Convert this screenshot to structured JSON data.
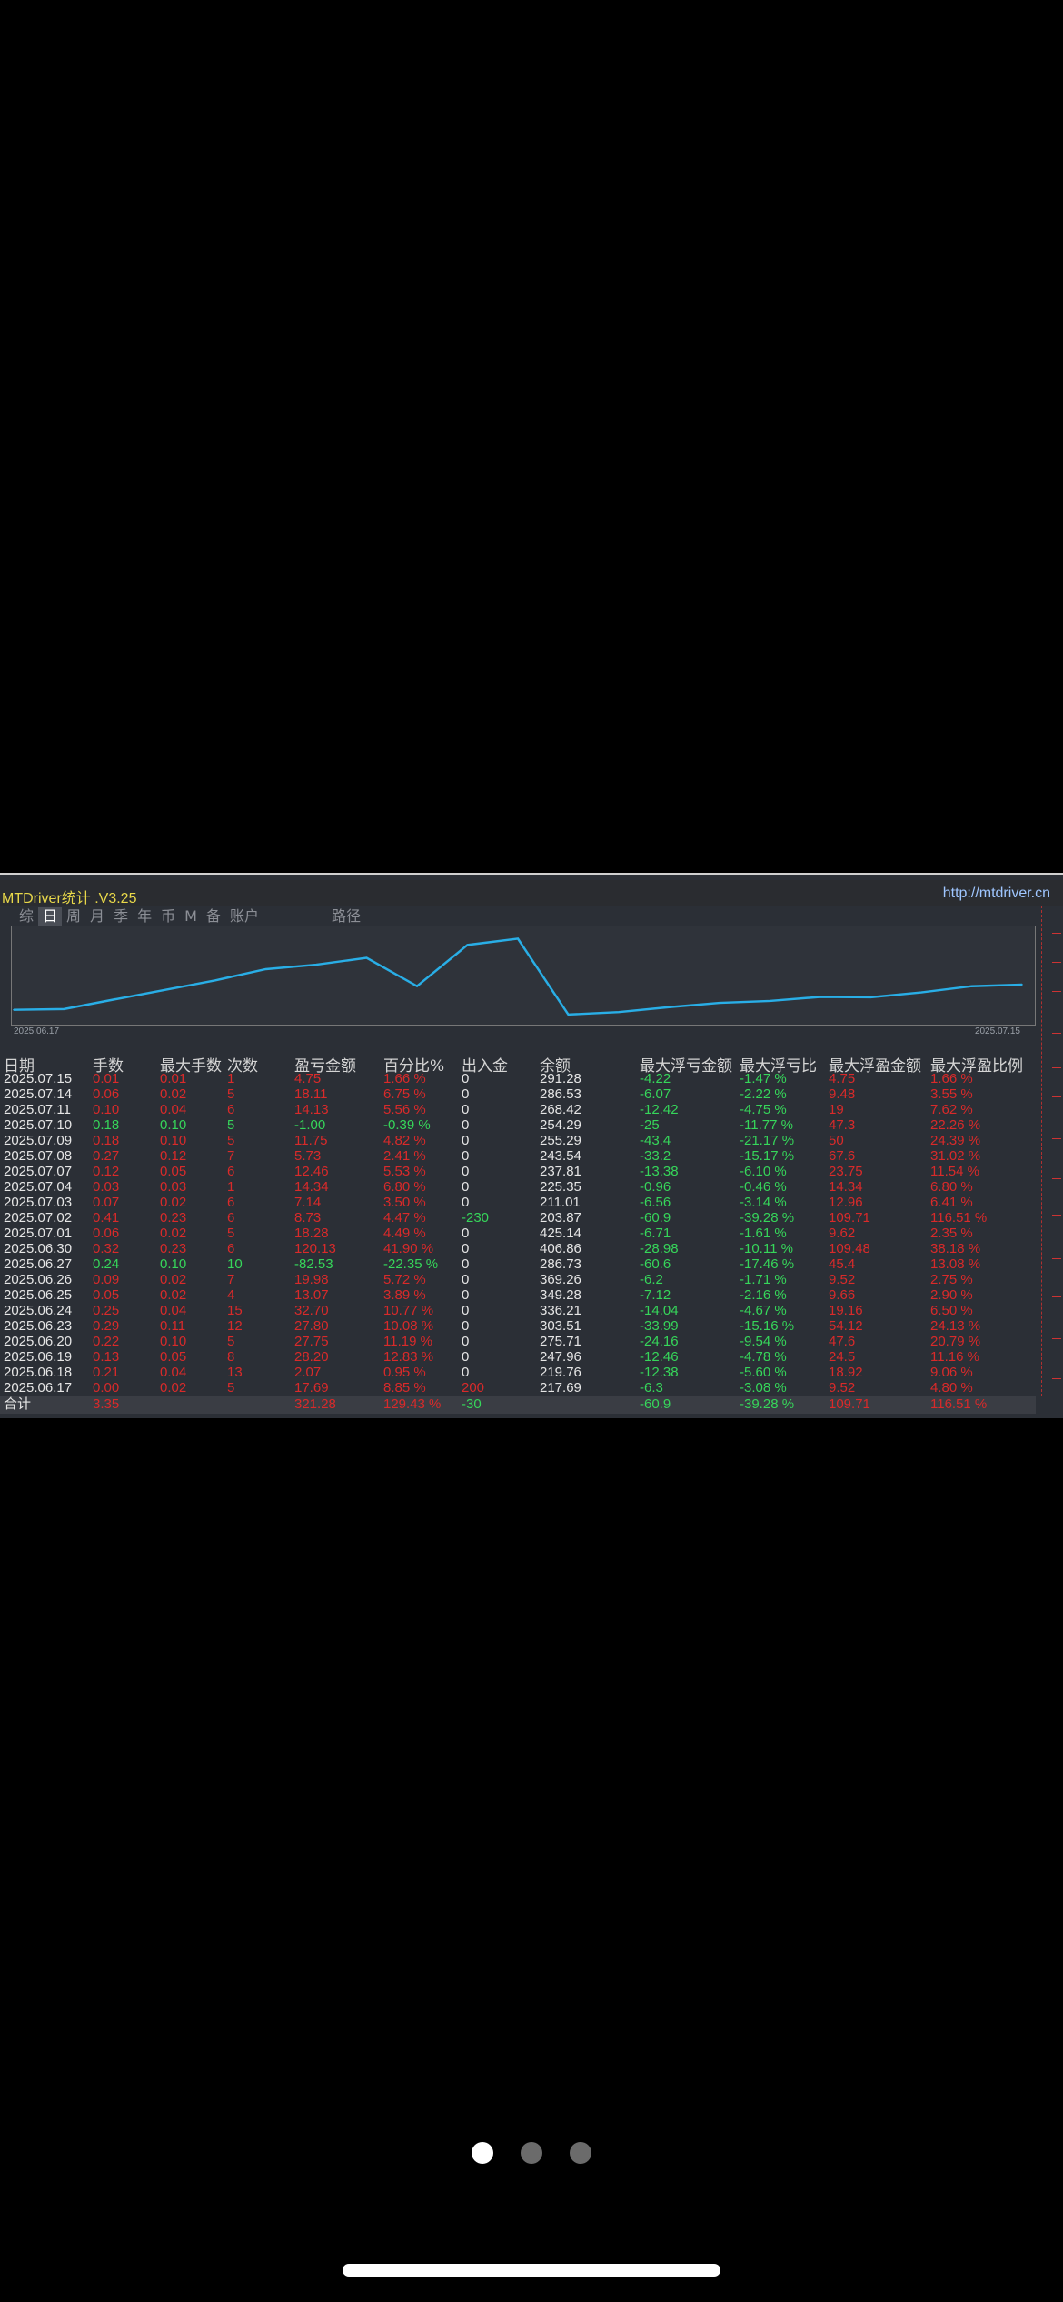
{
  "header": {
    "title": "MTDriver统计 .V3.25",
    "url": "http://mtdriver.cn"
  },
  "tabs": [
    {
      "label": "综"
    },
    {
      "label": "日"
    },
    {
      "label": "周"
    },
    {
      "label": "月"
    },
    {
      "label": "季"
    },
    {
      "label": "年"
    },
    {
      "label": "币"
    },
    {
      "label": "M"
    },
    {
      "label": "备"
    },
    {
      "label": "账户"
    },
    {
      "label": "路径"
    }
  ],
  "active_tab": "日",
  "chart": {
    "start_date": "2025.06.17",
    "end_date": "2025.07.15",
    "line_color": "#29aee6",
    "chart_data": {
      "type": "line",
      "x": [
        "2025.06.17",
        "2025.06.18",
        "2025.06.19",
        "2025.06.20",
        "2025.06.23",
        "2025.06.24",
        "2025.06.25",
        "2025.06.26",
        "2025.06.27",
        "2025.06.30",
        "2025.07.01",
        "2025.07.02",
        "2025.07.03",
        "2025.07.04",
        "2025.07.07",
        "2025.07.08",
        "2025.07.09",
        "2025.07.10",
        "2025.07.11",
        "2025.07.14",
        "2025.07.15"
      ],
      "series": [
        {
          "values": [
            217.69,
            219.76,
            247.96,
            275.71,
            303.51,
            336.21,
            349.28,
            369.26,
            286.73,
            406.86,
            425.14,
            203.87,
            211.01,
            225.35,
            237.81,
            243.54,
            255.29,
            254.29,
            268.42,
            286.53,
            291.28
          ]
        }
      ]
    }
  },
  "table": {
    "headers": [
      "日期",
      "手数",
      "最大手数",
      "次数",
      "盈亏金额",
      "百分比%",
      "出入金",
      "余额",
      "最大浮亏金额",
      "最大浮亏比",
      "最大浮盈金额",
      "最大浮盈比例"
    ],
    "rows": [
      [
        "2025.07.15",
        "0.01",
        "0.01",
        "1",
        "4.75",
        "1.66 %",
        "0",
        "291.28",
        "-4.22",
        "-1.47 %",
        "4.75",
        "1.66 %"
      ],
      [
        "2025.07.14",
        "0.06",
        "0.02",
        "5",
        "18.11",
        "6.75 %",
        "0",
        "286.53",
        "-6.07",
        "-2.22 %",
        "9.48",
        "3.55 %"
      ],
      [
        "2025.07.11",
        "0.10",
        "0.04",
        "6",
        "14.13",
        "5.56 %",
        "0",
        "268.42",
        "-12.42",
        "-4.75 %",
        "19",
        "7.62 %"
      ],
      [
        "2025.07.10",
        "0.18",
        "0.10",
        "5",
        "-1.00",
        "-0.39 %",
        "0",
        "254.29",
        "-25",
        "-11.77 %",
        "47.3",
        "22.26 %"
      ],
      [
        "2025.07.09",
        "0.18",
        "0.10",
        "5",
        "11.75",
        "4.82 %",
        "0",
        "255.29",
        "-43.4",
        "-21.17 %",
        "50",
        "24.39 %"
      ],
      [
        "2025.07.08",
        "0.27",
        "0.12",
        "7",
        "5.73",
        "2.41 %",
        "0",
        "243.54",
        "-33.2",
        "-15.17 %",
        "67.6",
        "31.02 %"
      ],
      [
        "2025.07.07",
        "0.12",
        "0.05",
        "6",
        "12.46",
        "5.53 %",
        "0",
        "237.81",
        "-13.38",
        "-6.10 %",
        "23.75",
        "11.54 %"
      ],
      [
        "2025.07.04",
        "0.03",
        "0.03",
        "1",
        "14.34",
        "6.80 %",
        "0",
        "225.35",
        "-0.96",
        "-0.46 %",
        "14.34",
        "6.80 %"
      ],
      [
        "2025.07.03",
        "0.07",
        "0.02",
        "6",
        "7.14",
        "3.50 %",
        "0",
        "211.01",
        "-6.56",
        "-3.14 %",
        "12.96",
        "6.41 %"
      ],
      [
        "2025.07.02",
        "0.41",
        "0.23",
        "6",
        "8.73",
        "4.47 %",
        "-230",
        "203.87",
        "-60.9",
        "-39.28 %",
        "109.71",
        "116.51 %"
      ],
      [
        "2025.07.01",
        "0.06",
        "0.02",
        "5",
        "18.28",
        "4.49 %",
        "0",
        "425.14",
        "-6.71",
        "-1.61 %",
        "9.62",
        "2.35 %"
      ],
      [
        "2025.06.30",
        "0.32",
        "0.23",
        "6",
        "120.13",
        "41.90 %",
        "0",
        "406.86",
        "-28.98",
        "-10.11 %",
        "109.48",
        "38.18 %"
      ],
      [
        "2025.06.27",
        "0.24",
        "0.10",
        "10",
        "-82.53",
        "-22.35 %",
        "0",
        "286.73",
        "-60.6",
        "-17.46 %",
        "45.4",
        "13.08 %"
      ],
      [
        "2025.06.26",
        "0.09",
        "0.02",
        "7",
        "19.98",
        "5.72 %",
        "0",
        "369.26",
        "-6.2",
        "-1.71 %",
        "9.52",
        "2.75 %"
      ],
      [
        "2025.06.25",
        "0.05",
        "0.02",
        "4",
        "13.07",
        "3.89 %",
        "0",
        "349.28",
        "-7.12",
        "-2.16 %",
        "9.66",
        "2.90 %"
      ],
      [
        "2025.06.24",
        "0.25",
        "0.04",
        "15",
        "32.70",
        "10.77 %",
        "0",
        "336.21",
        "-14.04",
        "-4.67 %",
        "19.16",
        "6.50 %"
      ],
      [
        "2025.06.23",
        "0.29",
        "0.11",
        "12",
        "27.80",
        "10.08 %",
        "0",
        "303.51",
        "-33.99",
        "-15.16 %",
        "54.12",
        "24.13 %"
      ],
      [
        "2025.06.20",
        "0.22",
        "0.10",
        "5",
        "27.75",
        "11.19 %",
        "0",
        "275.71",
        "-24.16",
        "-9.54 %",
        "47.6",
        "20.79 %"
      ],
      [
        "2025.06.19",
        "0.13",
        "0.05",
        "8",
        "28.20",
        "12.83 %",
        "0",
        "247.96",
        "-12.46",
        "-4.78 %",
        "24.5",
        "11.16 %"
      ],
      [
        "2025.06.18",
        "0.21",
        "0.04",
        "13",
        "2.07",
        "0.95 %",
        "0",
        "219.76",
        "-12.38",
        "-5.60 %",
        "18.92",
        "9.06 %"
      ],
      [
        "2025.06.17",
        "0.00",
        "0.02",
        "5",
        "17.69",
        "8.85 %",
        "200",
        "217.69",
        "-6.3",
        "-3.08 %",
        "9.52",
        "4.80 %"
      ]
    ],
    "total": [
      "合计",
      "3.35",
      "",
      "",
      "321.28",
      "129.43 %",
      "-30",
      "",
      "-60.9",
      "-39.28 %",
      "109.71",
      "116.51 %"
    ],
    "colors": {
      "loss": "#d92a2a",
      "gain": "#36d65a",
      "neutral": "#e6e6e6"
    }
  },
  "pagination": {
    "count": 3,
    "active_index": 0
  }
}
